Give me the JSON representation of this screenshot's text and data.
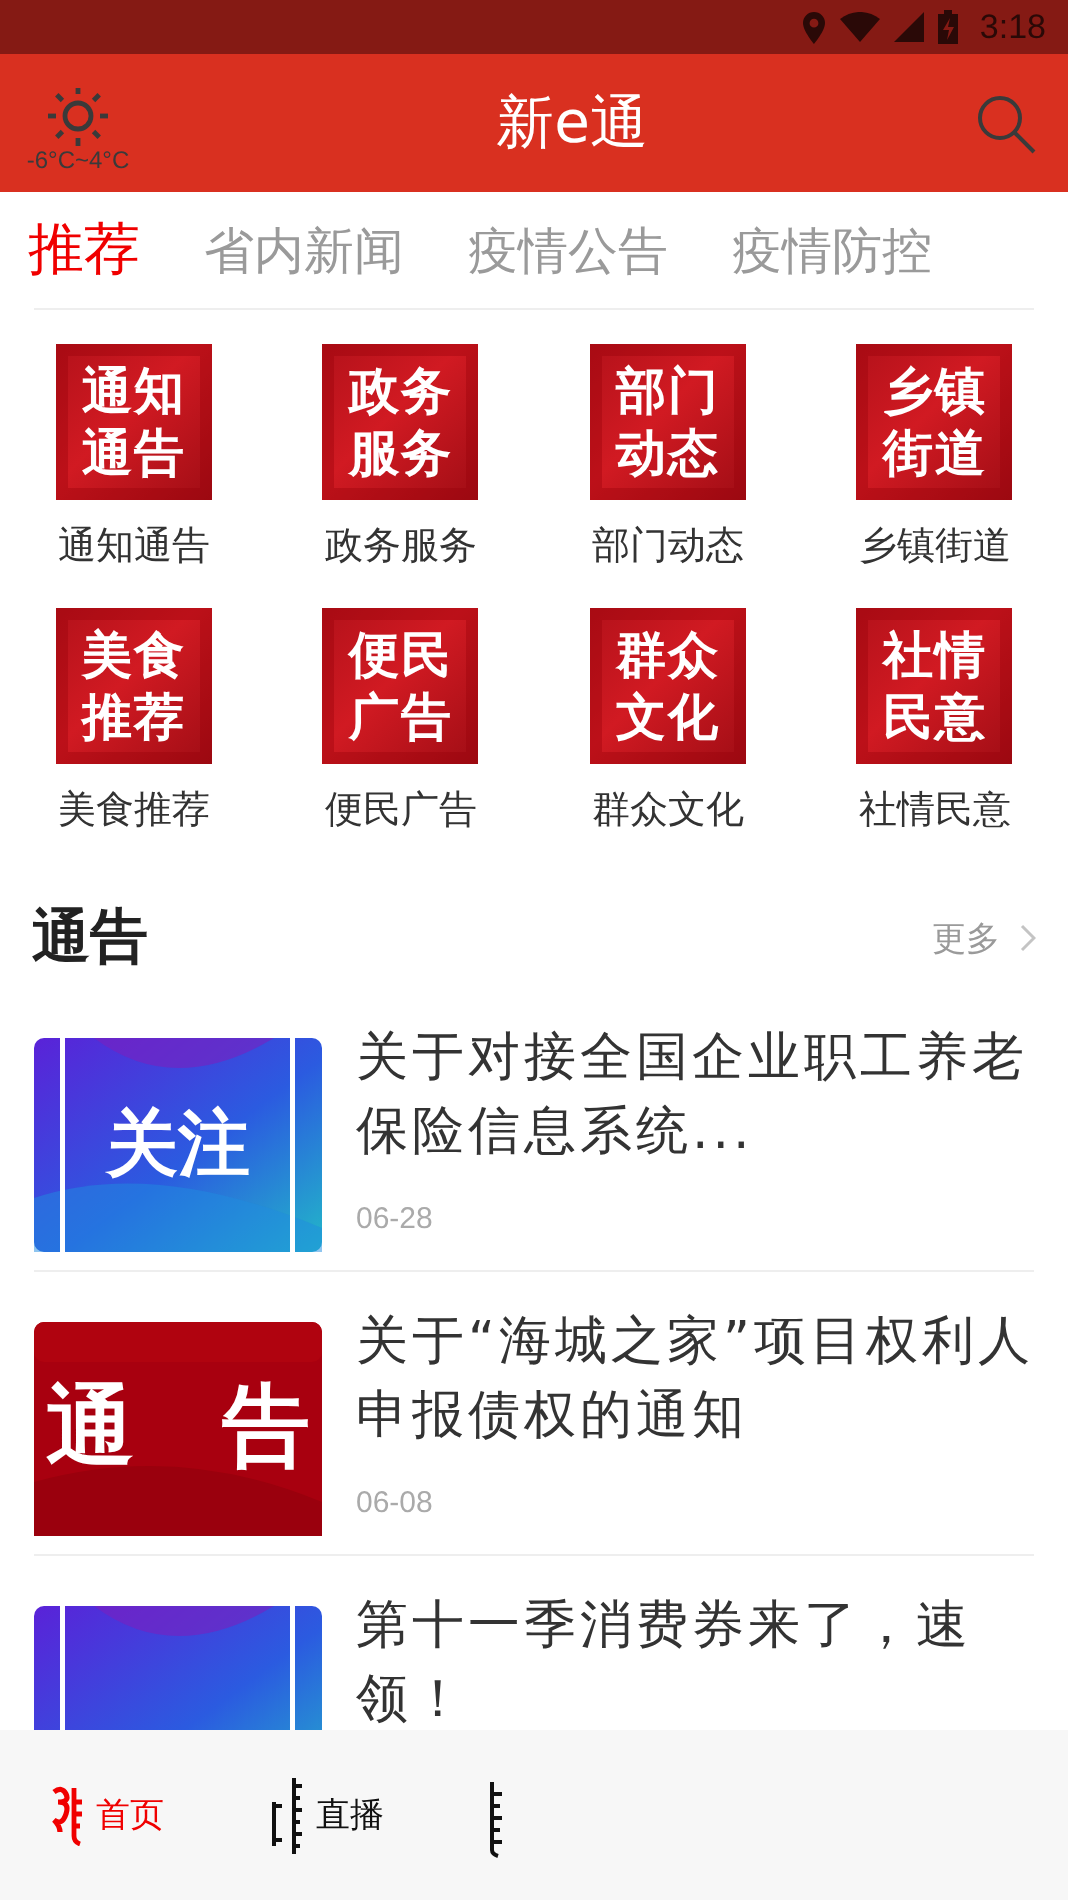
{
  "status_bar": {
    "time": "3:18"
  },
  "header": {
    "title": "新e通",
    "weather": "-6°C~4°C"
  },
  "tabs": [
    {
      "label": "推荐",
      "selected": true
    },
    {
      "label": "省内新闻",
      "selected": false
    },
    {
      "label": "疫情公告",
      "selected": false
    },
    {
      "label": "疫情防控",
      "selected": false
    }
  ],
  "shortcuts": [
    {
      "tile": [
        "通知",
        "通告"
      ],
      "label": "通知通告"
    },
    {
      "tile": [
        "政务",
        "服务"
      ],
      "label": "政务服务"
    },
    {
      "tile": [
        "部门",
        "动态"
      ],
      "label": "部门动态"
    },
    {
      "tile": [
        "乡镇",
        "街道"
      ],
      "label": "乡镇街道"
    },
    {
      "tile": [
        "美食",
        "推荐"
      ],
      "label": "美食推荐"
    },
    {
      "tile": [
        "便民",
        "广告"
      ],
      "label": "便民广告"
    },
    {
      "tile": [
        "群众",
        "文化"
      ],
      "label": "群众文化"
    },
    {
      "tile": [
        "社情",
        "民意"
      ],
      "label": "社情民意"
    }
  ],
  "section": {
    "title": "通告",
    "more": "更多"
  },
  "articles": [
    {
      "thumb": "关注",
      "kind": "blue",
      "title": "关于对接全国企业职工养老保险信息系统...",
      "date": "06-28"
    },
    {
      "thumb": "通　告",
      "kind": "red",
      "title": "关于“海城之家”项目权利人申报债权的通知",
      "date": "06-08"
    },
    {
      "kind": "blue",
      "title": "第十一季消费券来了，速领！"
    }
  ],
  "bottom_nav": [
    {
      "label": "首页",
      "selected": true
    },
    {
      "label": "直播",
      "selected": false
    },
    {
      "selected": false
    }
  ]
}
